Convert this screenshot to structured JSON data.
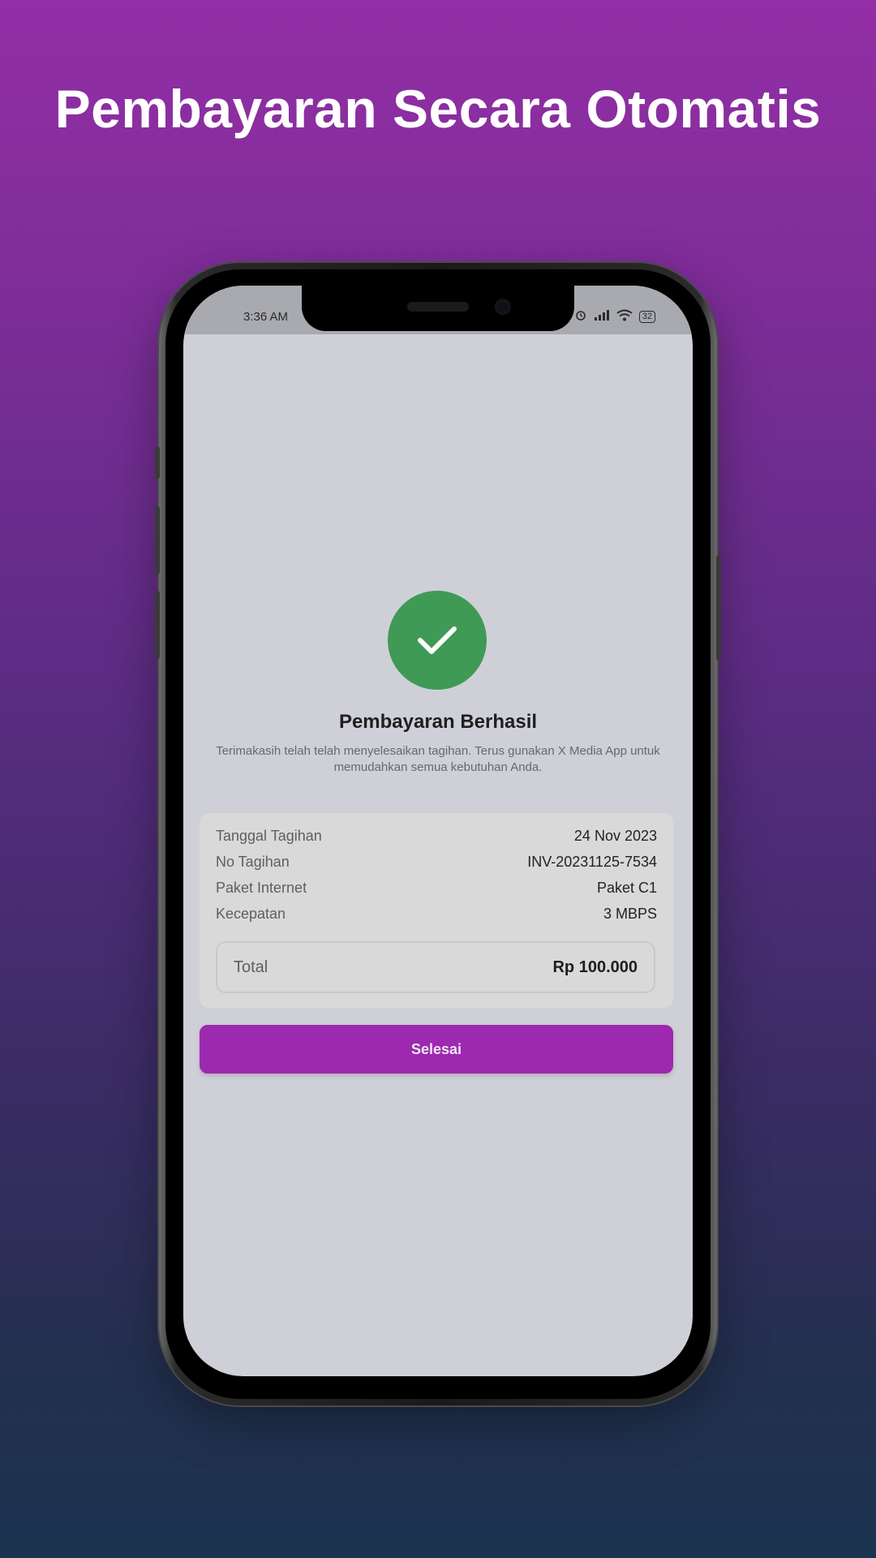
{
  "promo": {
    "headline": "Pembayaran Secara Otomatis"
  },
  "status_bar": {
    "time": "3:36 AM",
    "battery": "32"
  },
  "payment": {
    "title": "Pembayaran Berhasil",
    "message": "Terimakasih telah telah menyelesaikan tagihan. Terus gunakan X Media App untuk memudahkan semua kebutuhan Anda.",
    "success_color": "#3f9a56",
    "details": [
      {
        "label": "Tanggal Tagihan",
        "value": "24 Nov 2023"
      },
      {
        "label": "No Tagihan",
        "value": "INV-20231125-7534"
      },
      {
        "label": "Paket Internet",
        "value": "Paket C1"
      },
      {
        "label": "Kecepatan",
        "value": "3 MBPS"
      }
    ],
    "total_label": "Total",
    "total_value": "Rp 100.000",
    "done_button": "Selesai",
    "accent_color": "#9d29b0"
  }
}
